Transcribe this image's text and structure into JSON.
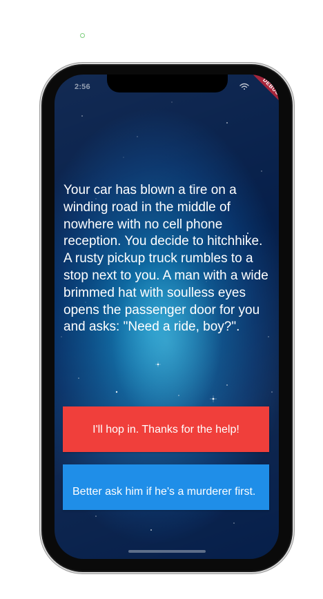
{
  "status_bar": {
    "time": "2:56",
    "icons": [
      "wifi-icon",
      "battery-icon"
    ]
  },
  "debug_banner": {
    "label": "DEBUG"
  },
  "story": {
    "text": "Your car has blown a tire on a winding road in the middle of nowhere with no cell phone reception. You decide to hitchhike. A rusty pickup truck rumbles to a stop next to you. A man with a wide brimmed hat with soulless eyes opens the passenger door for you and asks: \"Need a ride, boy?\"."
  },
  "choices": {
    "choice1_label": "I'll hop in. Thanks for the help!",
    "choice2_label": "Better ask him if he's a murderer first."
  },
  "colors": {
    "choice1_bg": "#f03f3b",
    "choice2_bg": "#1f8ee8",
    "debug_ribbon": "#a7263b",
    "background_deep": "#061f4a",
    "background_glow": "#1a8fc4"
  }
}
